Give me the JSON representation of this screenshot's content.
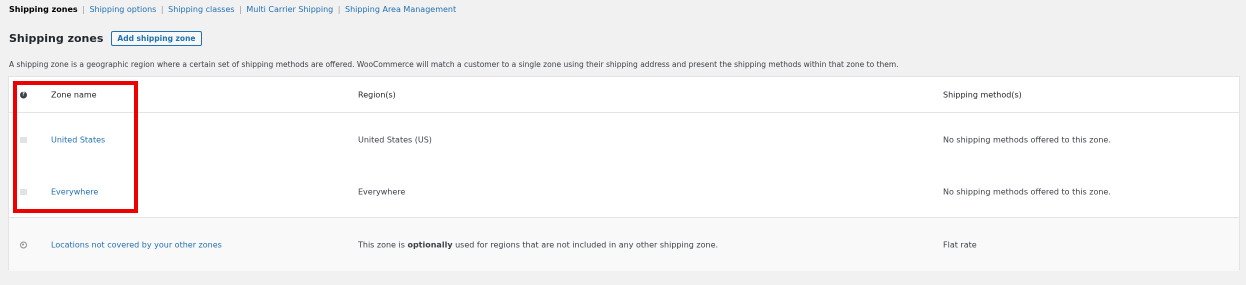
{
  "subnav": {
    "items": [
      {
        "label": "Shipping zones",
        "current": true
      },
      {
        "label": "Shipping options",
        "current": false
      },
      {
        "label": "Shipping classes",
        "current": false
      },
      {
        "label": "Multi Carrier Shipping",
        "current": false
      },
      {
        "label": "Shipping Area Management",
        "current": false
      }
    ],
    "separator": "|"
  },
  "heading": {
    "title": "Shipping zones",
    "add_button_label": "Add shipping zone"
  },
  "description": "A shipping zone is a geographic region where a certain set of shipping methods are offered. WooCommerce will match a customer to a single zone using their shipping address and present the shipping methods within that zone to them.",
  "table": {
    "headers": {
      "help_icon": "help-icon",
      "zone_name": "Zone name",
      "regions": "Region(s)",
      "methods": "Shipping method(s)"
    },
    "rows": [
      {
        "zone_name": "United States",
        "regions": "United States (US)",
        "methods": "No shipping methods offered to this zone.",
        "icon": "drag-handle-icon"
      },
      {
        "zone_name": "Everywhere",
        "regions": "Everywhere",
        "methods": "No shipping methods offered to this zone.",
        "icon": "drag-handle-icon"
      }
    ],
    "fallback_row": {
      "zone_name": "Locations not covered by your other zones",
      "regions_prefix": "This zone is ",
      "regions_emphasis": "optionally",
      "regions_suffix": " used for regions that are not included in any other shipping zone.",
      "methods": "Flat rate",
      "icon": "globe-icon"
    }
  },
  "colors": {
    "link": "#2271b1",
    "highlight_box": "#ec0000",
    "background": "#f1f1f1"
  }
}
